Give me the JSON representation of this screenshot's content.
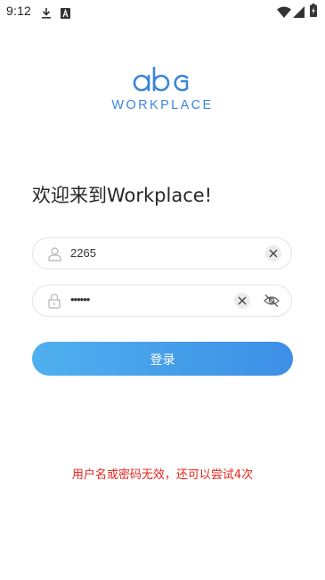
{
  "status_bar": {
    "time": "9:12",
    "left_icons": [
      "download-icon",
      "a-box-icon"
    ],
    "right_icons": [
      "wifi-icon",
      "signal-icon",
      "battery-charging-icon"
    ]
  },
  "logo": {
    "mark_text": "abg",
    "wordmark": "WORKPLACE",
    "color": "#3a86d9"
  },
  "welcome_text": "欢迎来到Workplace!",
  "username_field": {
    "value": "2265",
    "icon": "user-icon"
  },
  "password_field": {
    "value": "••••••",
    "icon": "lock-icon",
    "visibility_icon": "eye-off-icon"
  },
  "login_button": {
    "label": "登录",
    "gradient": [
      "#4fb0ee",
      "#3d8fe6"
    ]
  },
  "error_message": {
    "text": "用户名或密码无效，还可以尝试4次",
    "color": "#e8231b"
  }
}
